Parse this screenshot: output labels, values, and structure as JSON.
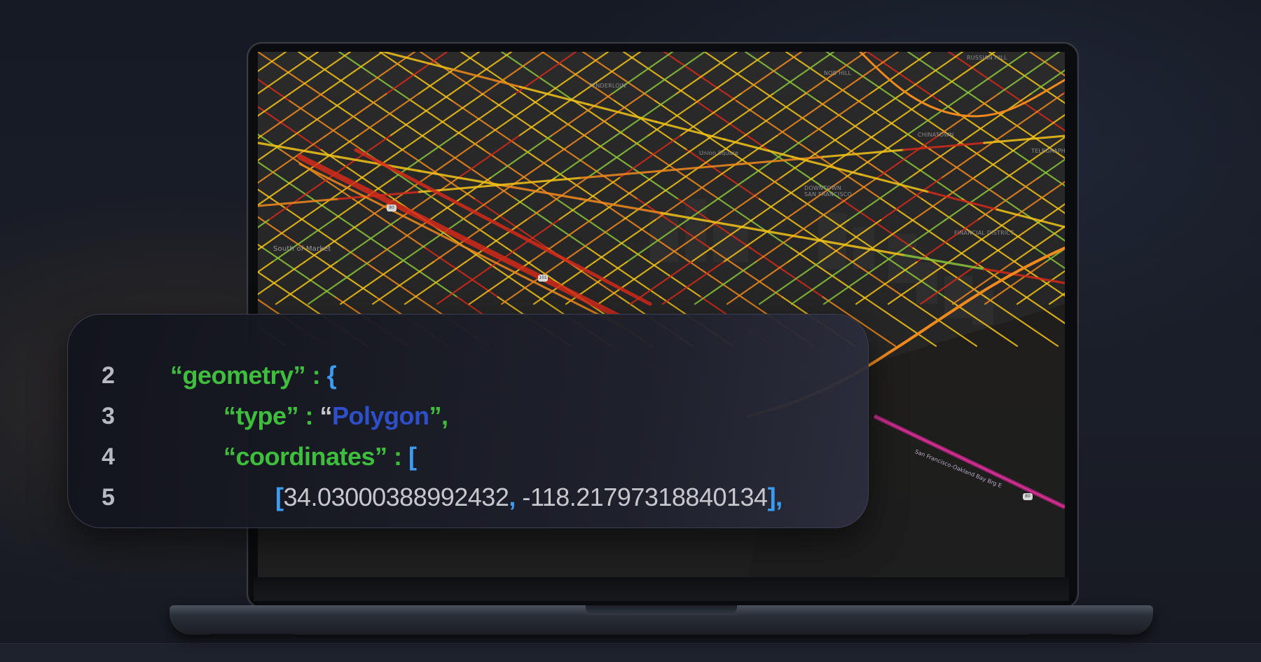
{
  "code": {
    "lines": [
      {
        "num": "2",
        "key": "“geometry”",
        "sep": " : ",
        "open": "{"
      },
      {
        "num": "3",
        "key": "“type”",
        "sep": " : ",
        "quote_open": "“",
        "value": "Polygon",
        "quote_close": "”,",
        "comma": ""
      },
      {
        "num": "4",
        "key": "“coordinates”",
        "sep": " : ",
        "open": "["
      },
      {
        "num": "5",
        "bracket_open": "[",
        "lat": "34.03000388992432",
        "mid_comma": ",",
        "lng": " -118.21797318840134",
        "bracket_close": "]",
        "end_comma": ","
      }
    ]
  },
  "map": {
    "labels": {
      "south_of_market": "South of Market",
      "union_square": "Union Square",
      "downtown": "DOWNTOWN\nSAN FRANCISCO",
      "financial_district": "FINANCIAL DISTRICT",
      "telegraph": "TELEGRAPH H",
      "tenderloin": "TENDERLOIN",
      "nob_hill": "NOB HILL",
      "russian_hill": "RUSSIAN HILL",
      "chinatown": "CHINATOWN",
      "bridge": "San Francisco-Oakland Bay Brg E"
    },
    "shields": {
      "s1": "80",
      "s2": "101",
      "s3": "80"
    }
  },
  "colors": {
    "background": "#171b25",
    "traffic_red": "#d42a1a",
    "traffic_orange": "#f08a1c",
    "traffic_yellow": "#f3c318",
    "traffic_green": "#8bc63a",
    "code_key_green": "#3fbe3d",
    "code_brace_blue": "#3b9cf2",
    "code_string_blue": "#2f4fc8"
  }
}
